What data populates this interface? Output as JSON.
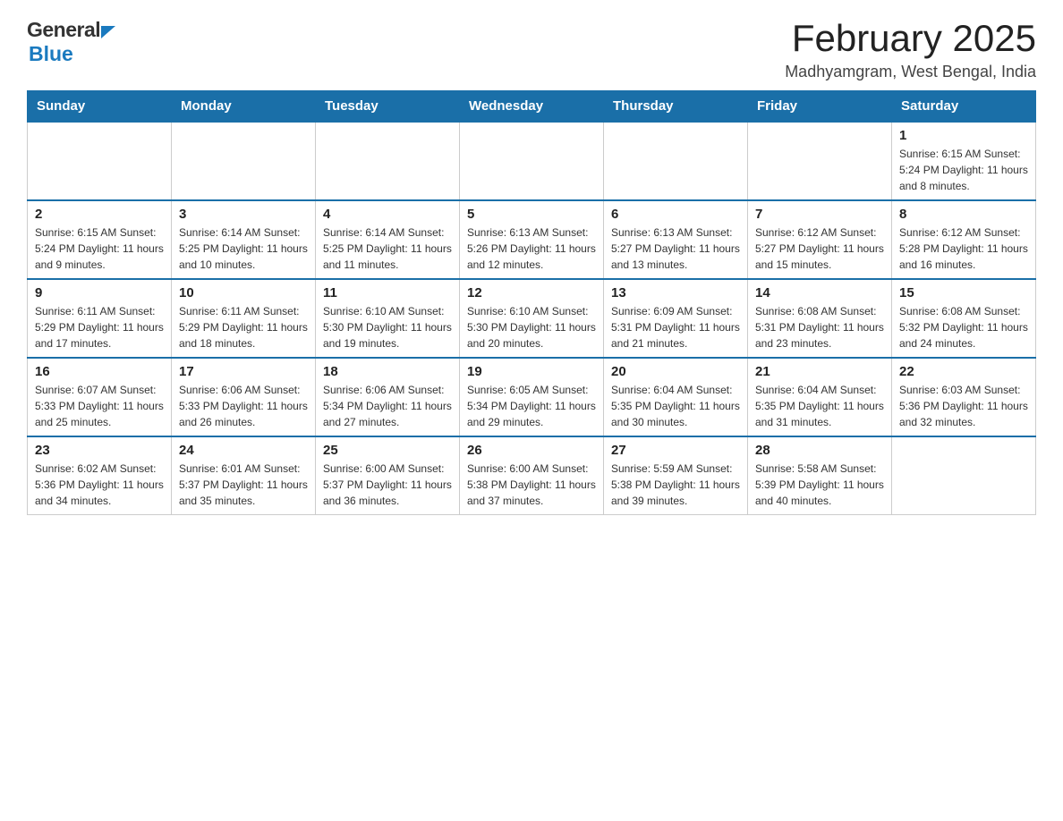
{
  "header": {
    "logo_general": "General",
    "logo_blue": "Blue",
    "title": "February 2025",
    "location": "Madhyamgram, West Bengal, India"
  },
  "days_of_week": [
    "Sunday",
    "Monday",
    "Tuesday",
    "Wednesday",
    "Thursday",
    "Friday",
    "Saturday"
  ],
  "weeks": [
    [
      {
        "day": "",
        "info": ""
      },
      {
        "day": "",
        "info": ""
      },
      {
        "day": "",
        "info": ""
      },
      {
        "day": "",
        "info": ""
      },
      {
        "day": "",
        "info": ""
      },
      {
        "day": "",
        "info": ""
      },
      {
        "day": "1",
        "info": "Sunrise: 6:15 AM\nSunset: 5:24 PM\nDaylight: 11 hours and 8 minutes."
      }
    ],
    [
      {
        "day": "2",
        "info": "Sunrise: 6:15 AM\nSunset: 5:24 PM\nDaylight: 11 hours and 9 minutes."
      },
      {
        "day": "3",
        "info": "Sunrise: 6:14 AM\nSunset: 5:25 PM\nDaylight: 11 hours and 10 minutes."
      },
      {
        "day": "4",
        "info": "Sunrise: 6:14 AM\nSunset: 5:25 PM\nDaylight: 11 hours and 11 minutes."
      },
      {
        "day": "5",
        "info": "Sunrise: 6:13 AM\nSunset: 5:26 PM\nDaylight: 11 hours and 12 minutes."
      },
      {
        "day": "6",
        "info": "Sunrise: 6:13 AM\nSunset: 5:27 PM\nDaylight: 11 hours and 13 minutes."
      },
      {
        "day": "7",
        "info": "Sunrise: 6:12 AM\nSunset: 5:27 PM\nDaylight: 11 hours and 15 minutes."
      },
      {
        "day": "8",
        "info": "Sunrise: 6:12 AM\nSunset: 5:28 PM\nDaylight: 11 hours and 16 minutes."
      }
    ],
    [
      {
        "day": "9",
        "info": "Sunrise: 6:11 AM\nSunset: 5:29 PM\nDaylight: 11 hours and 17 minutes."
      },
      {
        "day": "10",
        "info": "Sunrise: 6:11 AM\nSunset: 5:29 PM\nDaylight: 11 hours and 18 minutes."
      },
      {
        "day": "11",
        "info": "Sunrise: 6:10 AM\nSunset: 5:30 PM\nDaylight: 11 hours and 19 minutes."
      },
      {
        "day": "12",
        "info": "Sunrise: 6:10 AM\nSunset: 5:30 PM\nDaylight: 11 hours and 20 minutes."
      },
      {
        "day": "13",
        "info": "Sunrise: 6:09 AM\nSunset: 5:31 PM\nDaylight: 11 hours and 21 minutes."
      },
      {
        "day": "14",
        "info": "Sunrise: 6:08 AM\nSunset: 5:31 PM\nDaylight: 11 hours and 23 minutes."
      },
      {
        "day": "15",
        "info": "Sunrise: 6:08 AM\nSunset: 5:32 PM\nDaylight: 11 hours and 24 minutes."
      }
    ],
    [
      {
        "day": "16",
        "info": "Sunrise: 6:07 AM\nSunset: 5:33 PM\nDaylight: 11 hours and 25 minutes."
      },
      {
        "day": "17",
        "info": "Sunrise: 6:06 AM\nSunset: 5:33 PM\nDaylight: 11 hours and 26 minutes."
      },
      {
        "day": "18",
        "info": "Sunrise: 6:06 AM\nSunset: 5:34 PM\nDaylight: 11 hours and 27 minutes."
      },
      {
        "day": "19",
        "info": "Sunrise: 6:05 AM\nSunset: 5:34 PM\nDaylight: 11 hours and 29 minutes."
      },
      {
        "day": "20",
        "info": "Sunrise: 6:04 AM\nSunset: 5:35 PM\nDaylight: 11 hours and 30 minutes."
      },
      {
        "day": "21",
        "info": "Sunrise: 6:04 AM\nSunset: 5:35 PM\nDaylight: 11 hours and 31 minutes."
      },
      {
        "day": "22",
        "info": "Sunrise: 6:03 AM\nSunset: 5:36 PM\nDaylight: 11 hours and 32 minutes."
      }
    ],
    [
      {
        "day": "23",
        "info": "Sunrise: 6:02 AM\nSunset: 5:36 PM\nDaylight: 11 hours and 34 minutes."
      },
      {
        "day": "24",
        "info": "Sunrise: 6:01 AM\nSunset: 5:37 PM\nDaylight: 11 hours and 35 minutes."
      },
      {
        "day": "25",
        "info": "Sunrise: 6:00 AM\nSunset: 5:37 PM\nDaylight: 11 hours and 36 minutes."
      },
      {
        "day": "26",
        "info": "Sunrise: 6:00 AM\nSunset: 5:38 PM\nDaylight: 11 hours and 37 minutes."
      },
      {
        "day": "27",
        "info": "Sunrise: 5:59 AM\nSunset: 5:38 PM\nDaylight: 11 hours and 39 minutes."
      },
      {
        "day": "28",
        "info": "Sunrise: 5:58 AM\nSunset: 5:39 PM\nDaylight: 11 hours and 40 minutes."
      },
      {
        "day": "",
        "info": ""
      }
    ]
  ]
}
